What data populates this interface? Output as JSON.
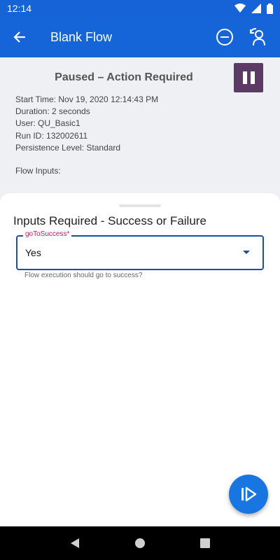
{
  "status_bar": {
    "time": "12:14"
  },
  "app_bar": {
    "title": "Blank Flow"
  },
  "run_info": {
    "status": "Paused – Action Required",
    "start_time": "Start Time: Nov 19, 2020 12:14:43 PM",
    "duration": "Duration: 2 seconds",
    "user": "User: QU_Basic1",
    "run_id": "Run ID: 132002611",
    "persistence": "Persistence Level: Standard",
    "flow_inputs_label": "Flow Inputs:"
  },
  "inputs_sheet": {
    "title": "Inputs Required - Success or Failure",
    "field_label": "goToSuccess*",
    "field_value": "Yes",
    "field_help": "Flow execution should go to success?"
  },
  "colors": {
    "app_bar": "#1565d8",
    "pause_button": "#5b3a63",
    "fab": "#1976e0",
    "field_border": "#1a4fa8",
    "required_label": "#c2185b"
  },
  "icons": [
    "back-arrow-icon",
    "minus-circle-icon",
    "reassign-user-icon",
    "pause-icon",
    "resume-icon",
    "dropdown-arrow-icon",
    "nav-back-icon",
    "nav-home-icon",
    "nav-recents-icon",
    "wifi-icon",
    "signal-icon",
    "battery-icon"
  ]
}
